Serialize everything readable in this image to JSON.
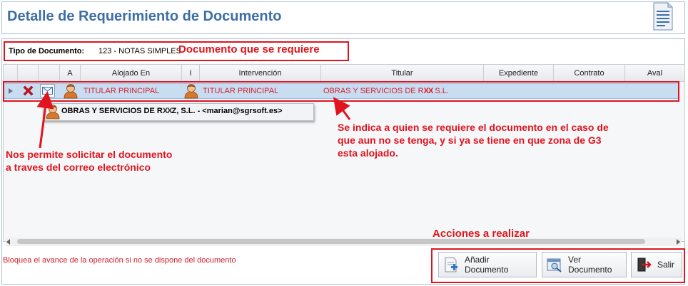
{
  "header": {
    "title": "Detalle de Requerimiento de Documento"
  },
  "tipo": {
    "label": "Tipo de Documento:",
    "value": "123 - NOTAS SIMPLES"
  },
  "grid": {
    "columns": [
      "A",
      "Alojado En",
      "I",
      "Intervención",
      "Titular",
      "Expediente",
      "Contrato",
      "Aval"
    ],
    "rows": [
      {
        "alojado_en": "TITULAR PRINCIPAL",
        "intervencion": "TITULAR PRINCIPAL",
        "titular": "OBRAS Y SERVICIOS DE R",
        "titular_mask": "XX",
        "titular_end": " S.L."
      }
    ]
  },
  "popup": {
    "text_a": "OBRAS Y SERVICIOS DE R",
    "mask": "XX",
    "text_b": "Z, S.L. - <marian@sgrsoft.es>"
  },
  "annotations": {
    "doc": "Documento que se requiere",
    "mail_1": "Nos permite solicitar el documento",
    "mail_2": "a traves del correo electrónico",
    "who_1": "Se indica a quien se requiere el documento en el caso de",
    "who_2": "que aun no se tenga, y si ya se tiene en que zona de G3",
    "who_3": "esta alojado.",
    "actions": "Acciones a realizar"
  },
  "footer": {
    "message": "Bloquea el avance de la operación si no se dispone del documento"
  },
  "buttons": {
    "add": "Añadir Documento",
    "view": "Ver Documento",
    "exit": "Salir"
  },
  "colors": {
    "annotation": "#e0141e",
    "title": "#3d6ea6",
    "row_selected": "#c8ddf2"
  },
  "icons": [
    "document-icon",
    "delete-icon",
    "mail-icon",
    "user-icon",
    "add-document-icon",
    "view-document-icon",
    "exit-icon"
  ]
}
